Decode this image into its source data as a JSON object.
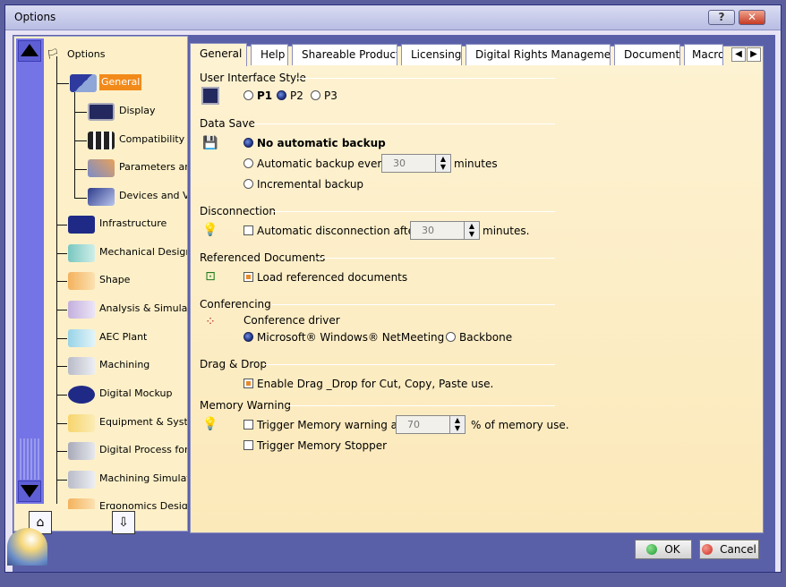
{
  "window": {
    "title": "Options",
    "help_label": "?",
    "close_label": "✕"
  },
  "tree": {
    "root": "Options",
    "items": [
      {
        "label": "General",
        "selected": true,
        "icon": "general-icon"
      },
      {
        "label": "Display",
        "icon": "display-icon"
      },
      {
        "label": "Compatibility",
        "icon": "compatibility-icon"
      },
      {
        "label": "Parameters and",
        "icon": "parameters-icon"
      },
      {
        "label": "Devices and Virt",
        "icon": "devices-icon"
      },
      {
        "label": "Infrastructure",
        "icon": "infrastructure-icon"
      },
      {
        "label": "Mechanical Design",
        "icon": "mechanical-design-icon"
      },
      {
        "label": "Shape",
        "icon": "shape-icon"
      },
      {
        "label": "Analysis & Simulatio",
        "icon": "analysis-icon"
      },
      {
        "label": "AEC Plant",
        "icon": "aec-plant-icon"
      },
      {
        "label": "Machining",
        "icon": "machining-icon"
      },
      {
        "label": "Digital Mockup",
        "icon": "digital-mockup-icon"
      },
      {
        "label": "Equipment & System",
        "icon": "equipment-icon"
      },
      {
        "label": "Digital Process for M",
        "icon": "digital-process-icon"
      },
      {
        "label": "Machining Simulatic",
        "icon": "machining-sim-icon"
      },
      {
        "label": "Ergonomics Design .",
        "icon": "ergonomics-icon"
      }
    ]
  },
  "tabs": [
    "General",
    "Help",
    "Shareable Products",
    "Licensing",
    "Digital Rights Management",
    "Document",
    "Macro"
  ],
  "sections": {
    "ui_style": {
      "title": "User Interface Style",
      "options": [
        "P1",
        "P2",
        "P3"
      ],
      "selected": "P2"
    },
    "data_save": {
      "title": "Data Save",
      "opt1": "No automatic backup",
      "opt2": "Automatic backup every",
      "opt2_value": "30",
      "opt2_unit": "minutes",
      "opt3": "Incremental backup"
    },
    "disconnection": {
      "title": "Disconnection",
      "label": "Automatic disconnection after",
      "value": "30",
      "unit": "minutes."
    },
    "referenced": {
      "title": "Referenced Documents",
      "label": "Load referenced documents"
    },
    "conferencing": {
      "title": "Conferencing",
      "driver_label": "Conference driver",
      "opt1": "Microsoft® Windows® NetMeeting®",
      "opt2": "Backbone"
    },
    "dragdrop": {
      "title": "Drag & Drop",
      "label": "Enable Drag _Drop for Cut, Copy, Paste use."
    },
    "memory": {
      "title": "Memory Warning",
      "trigger_label": "Trigger Memory warning at",
      "value": "70",
      "unit": "% of memory use.",
      "stopper_label": "Trigger Memory Stopper"
    }
  },
  "buttons": {
    "ok": "OK",
    "cancel": "Cancel"
  },
  "colors": {
    "selection": "#f28a1a",
    "panel": "#fdf2d2",
    "frame": "#5a60a8",
    "ok_green": "#1e9a2f",
    "cancel_red": "#d2261c"
  }
}
